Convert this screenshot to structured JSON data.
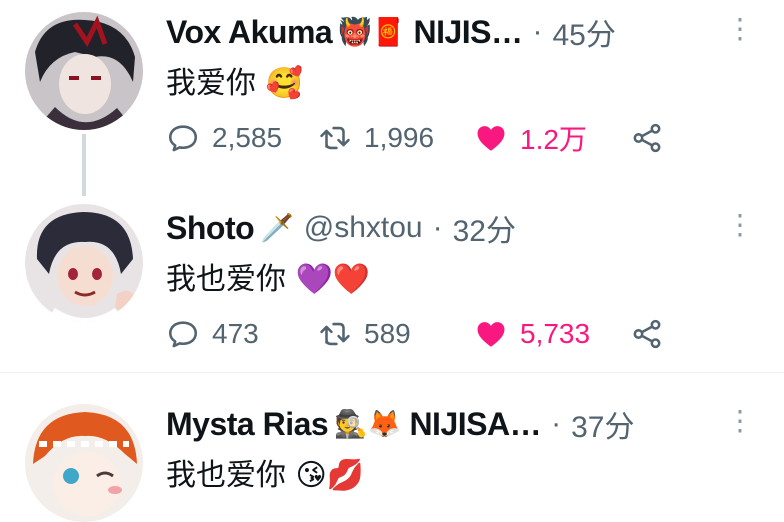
{
  "tweets": [
    {
      "name": "Vox Akuma",
      "emoji": "👹🧧",
      "suffix": "NIJIS…",
      "handle": "",
      "time": "45分",
      "text": "我爱你 🥰",
      "replies": "2,585",
      "retweets": "1,996",
      "likes": "1.2万"
    },
    {
      "name": "Shoto",
      "emoji": "🗡️",
      "suffix": "",
      "handle": "@shxtou",
      "time": "32分",
      "text": "我也爱你 💜❤️",
      "replies": "473",
      "retweets": "589",
      "likes": "5,733"
    },
    {
      "name": "Mysta Rias",
      "emoji": "🕵️🦊",
      "suffix": "NIJISA…",
      "handle": "",
      "time": "37分",
      "text": "我也爱你 😘💋"
    }
  ],
  "icons": {
    "reply": "reply-icon",
    "retweet": "retweet-icon",
    "like": "heart-icon",
    "share": "share-icon",
    "more": "more-icon"
  },
  "colors": {
    "like": "#f91880",
    "muted": "#536471",
    "thread_line": "#cfd9de"
  }
}
